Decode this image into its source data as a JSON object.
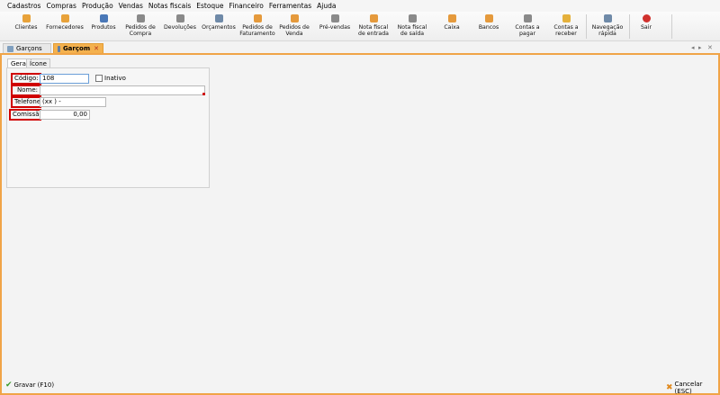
{
  "menu": [
    "Cadastros",
    "Compras",
    "Produção",
    "Vendas",
    "Notas fiscais",
    "Estoque",
    "Financeiro",
    "Ferramentas",
    "Ajuda"
  ],
  "toolbar": [
    {
      "label": "Clientes",
      "icon": "clients-icon",
      "color": "#e8a23a"
    },
    {
      "label": "Fornecedores",
      "icon": "suppliers-icon",
      "color": "#e8a23a"
    },
    {
      "label": "Produtos",
      "icon": "products-icon",
      "color": "#4a78b8"
    },
    {
      "label": "Pedidos de\nCompra",
      "icon": "purchase-orders-icon",
      "color": "#8a8a8a"
    },
    {
      "label": "Devoluções",
      "icon": "returns-icon",
      "color": "#8a8a8a"
    },
    {
      "label": "Orçamentos",
      "icon": "quotes-icon",
      "color": "#6f8aa8"
    },
    {
      "label": "Pedidos de\nFaturamento",
      "icon": "billing-orders-icon",
      "color": "#e59a3c"
    },
    {
      "label": "Pedidos de\nVenda",
      "icon": "sales-orders-icon",
      "color": "#e59a3c"
    },
    {
      "label": "Pré-vendas",
      "icon": "pre-sales-icon",
      "color": "#8a8a8a"
    },
    {
      "label": "Nota fiscal\nde entrada",
      "icon": "incoming-invoice-icon",
      "color": "#e59a3c"
    },
    {
      "label": "Nota fiscal\nde saída",
      "icon": "outgoing-invoice-icon",
      "color": "#8a8a8a"
    },
    {
      "label": "Caixa",
      "icon": "cash-register-icon",
      "color": "#e59a3c"
    },
    {
      "label": "Bancos",
      "icon": "banks-icon",
      "color": "#e59a3c"
    },
    {
      "label": "Contas a\npagar",
      "icon": "accounts-payable-icon",
      "color": "#8a8a8a"
    },
    {
      "label": "Contas a\nreceber",
      "icon": "accounts-receivable-icon",
      "color": "#e5b13c"
    },
    {
      "label": "Navegação\nrápida",
      "icon": "quick-navigation-icon",
      "color": "#6f8aa8"
    },
    {
      "label": "Sair",
      "icon": "exit-icon",
      "color": "#d0312d"
    }
  ],
  "tabs": [
    {
      "label": "Garçons",
      "active": false
    },
    {
      "label": "Garçom",
      "active": true
    }
  ],
  "subtabs": [
    "Geral",
    "Ícone"
  ],
  "form": {
    "codigo_label": "Código:",
    "codigo_value": "108",
    "inativo_label": "Inativo",
    "nome_label": "Nome:",
    "nome_value": "",
    "telefone_label": "Telefone:",
    "telefone_value": "(xx )   -",
    "comissao_label": "Comissão:",
    "comissao_value": "0,00"
  },
  "footer": {
    "save_label": "Gravar (F10)",
    "cancel_label": "Cancelar (ESC)"
  },
  "colors": {
    "accent_orange": "#f0a447",
    "highlight_red": "#d00000",
    "save_green": "#3a9a2a"
  }
}
